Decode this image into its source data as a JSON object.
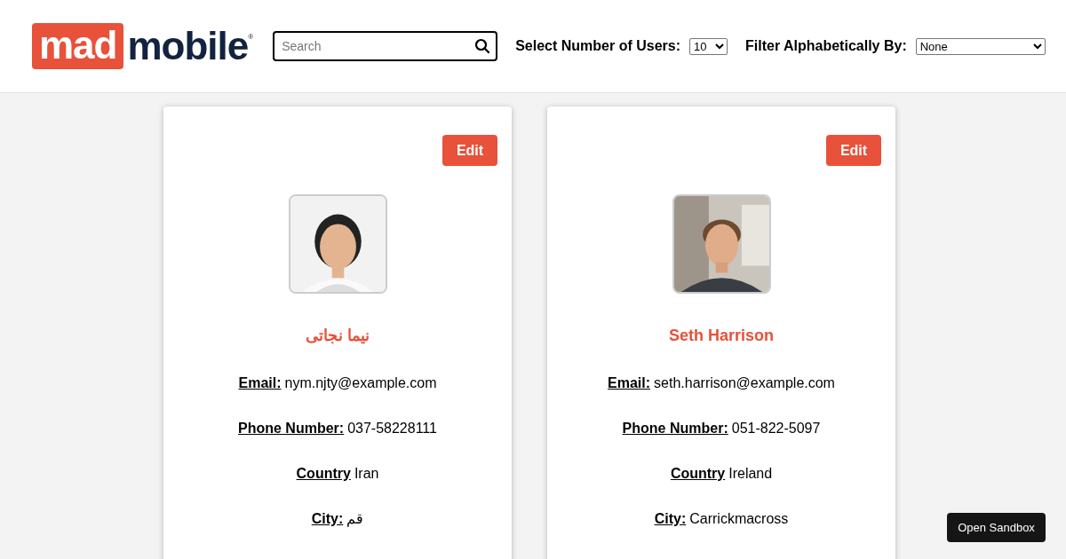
{
  "logo": {
    "part_1": "mad",
    "part_2": "mobile",
    "mark": "®"
  },
  "search": {
    "placeholder": "Search"
  },
  "user_count": {
    "label": "Select Number of Users:",
    "value": "10"
  },
  "filter": {
    "label": "Filter Alphabetically By:",
    "value": "None"
  },
  "users": [
    {
      "edit": "Edit",
      "name": "نیما نجاتی",
      "fields": [
        {
          "label": "Email:",
          "value": "nym.njty@example.com"
        },
        {
          "label": "Phone Number:",
          "value": "037-58228111"
        },
        {
          "label": "Country",
          "value": "Iran"
        },
        {
          "label": "City:",
          "value": "قم"
        }
      ]
    },
    {
      "edit": "Edit",
      "name": "Seth Harrison",
      "fields": [
        {
          "label": "Email:",
          "value": "seth.harrison@example.com"
        },
        {
          "label": "Phone Number:",
          "value": "051-822-5097"
        },
        {
          "label": "Country",
          "value": "Ireland"
        },
        {
          "label": "City:",
          "value": "Carrickmacross"
        }
      ]
    }
  ],
  "sandbox_button": "Open Sandbox"
}
